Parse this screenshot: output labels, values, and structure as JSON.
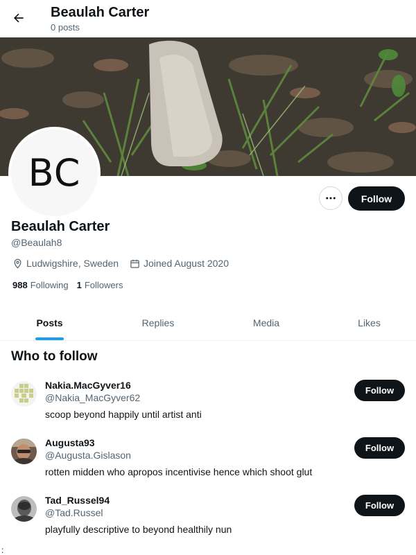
{
  "header": {
    "title": "Beaulah Carter",
    "post_count": "0 posts",
    "back_icon": "arrow-left-icon"
  },
  "profile": {
    "initials": "BC",
    "name": "Beaulah Carter",
    "handle": "@Beaulah8",
    "location": "Ludwigshire, Sweden",
    "joined": "Joined August 2020",
    "following_count": "988",
    "following_label": "Following",
    "followers_count": "1",
    "followers_label": "Followers",
    "follow_label": "Follow",
    "more_icon": "more-dots-icon"
  },
  "tabs": [
    {
      "label": "Posts",
      "active": true
    },
    {
      "label": "Replies",
      "active": false
    },
    {
      "label": "Media",
      "active": false
    },
    {
      "label": "Likes",
      "active": false
    }
  ],
  "who_to_follow": {
    "title": "Who to follow",
    "users": [
      {
        "name": "Nakia.MacGyver16",
        "handle": "@Nakia_MacGyver62",
        "bio": "scoop beyond happily until artist anti",
        "follow_label": "Follow"
      },
      {
        "name": "Augusta93",
        "handle": "@Augusta.Gislason",
        "bio": "rotten midden who apropos incentivise hence which shoot glut",
        "follow_label": "Follow"
      },
      {
        "name": "Tad_Russel94",
        "handle": "@Tad.Russel",
        "bio": "playfully descriptive to beyond healthily nun",
        "follow_label": "Follow"
      }
    ]
  },
  "footer_mark": ":",
  "colors": {
    "accent": "#1d9bf0",
    "text": "#0f1419",
    "muted": "#536471",
    "button": "#0f1419"
  }
}
